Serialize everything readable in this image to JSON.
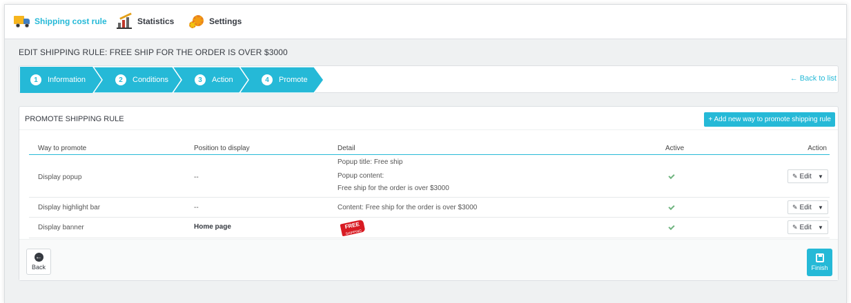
{
  "nav": {
    "tabs": [
      {
        "label": "Shipping cost rule",
        "icon": "truck-icon",
        "active": true
      },
      {
        "label": "Statistics",
        "icon": "chart-icon",
        "active": false
      },
      {
        "label": "Settings",
        "icon": "gear-icon",
        "active": false
      }
    ]
  },
  "page_title": "EDIT SHIPPING RULE: FREE SHIP FOR THE ORDER IS OVER $3000",
  "wizard": {
    "steps": [
      {
        "num": "1",
        "label": "Information"
      },
      {
        "num": "2",
        "label": "Conditions"
      },
      {
        "num": "3",
        "label": "Action"
      },
      {
        "num": "4",
        "label": "Promote"
      }
    ],
    "back_to_list": "← Back to list"
  },
  "panel": {
    "title": "PROMOTE SHIPPING RULE",
    "add_button": "+ Add new way to promote shipping rule",
    "columns": [
      "Way to promote",
      "Position to display",
      "Detail",
      "Active",
      "Action"
    ],
    "rows": [
      {
        "way": "Display popup",
        "position": "--",
        "detail_lines": [
          "Popup title: Free ship",
          "Popup content:",
          "Free ship for the order is over $3000"
        ],
        "active": true,
        "action": "Edit"
      },
      {
        "way": "Display highlight bar",
        "position": "--",
        "detail_lines": [
          "Content: Free ship for the order is over $3000"
        ],
        "active": true,
        "action": "Edit"
      },
      {
        "way": "Display banner",
        "position": "Home page",
        "detail_banner": {
          "big": "FREE",
          "small": "SHIPPING"
        },
        "active": true,
        "action": "Edit"
      }
    ],
    "back_label": "Back",
    "finish_label": "Finish"
  },
  "colors": {
    "accent": "#25b9d7",
    "check": "#70b580",
    "banner_red": "#d81b23"
  }
}
